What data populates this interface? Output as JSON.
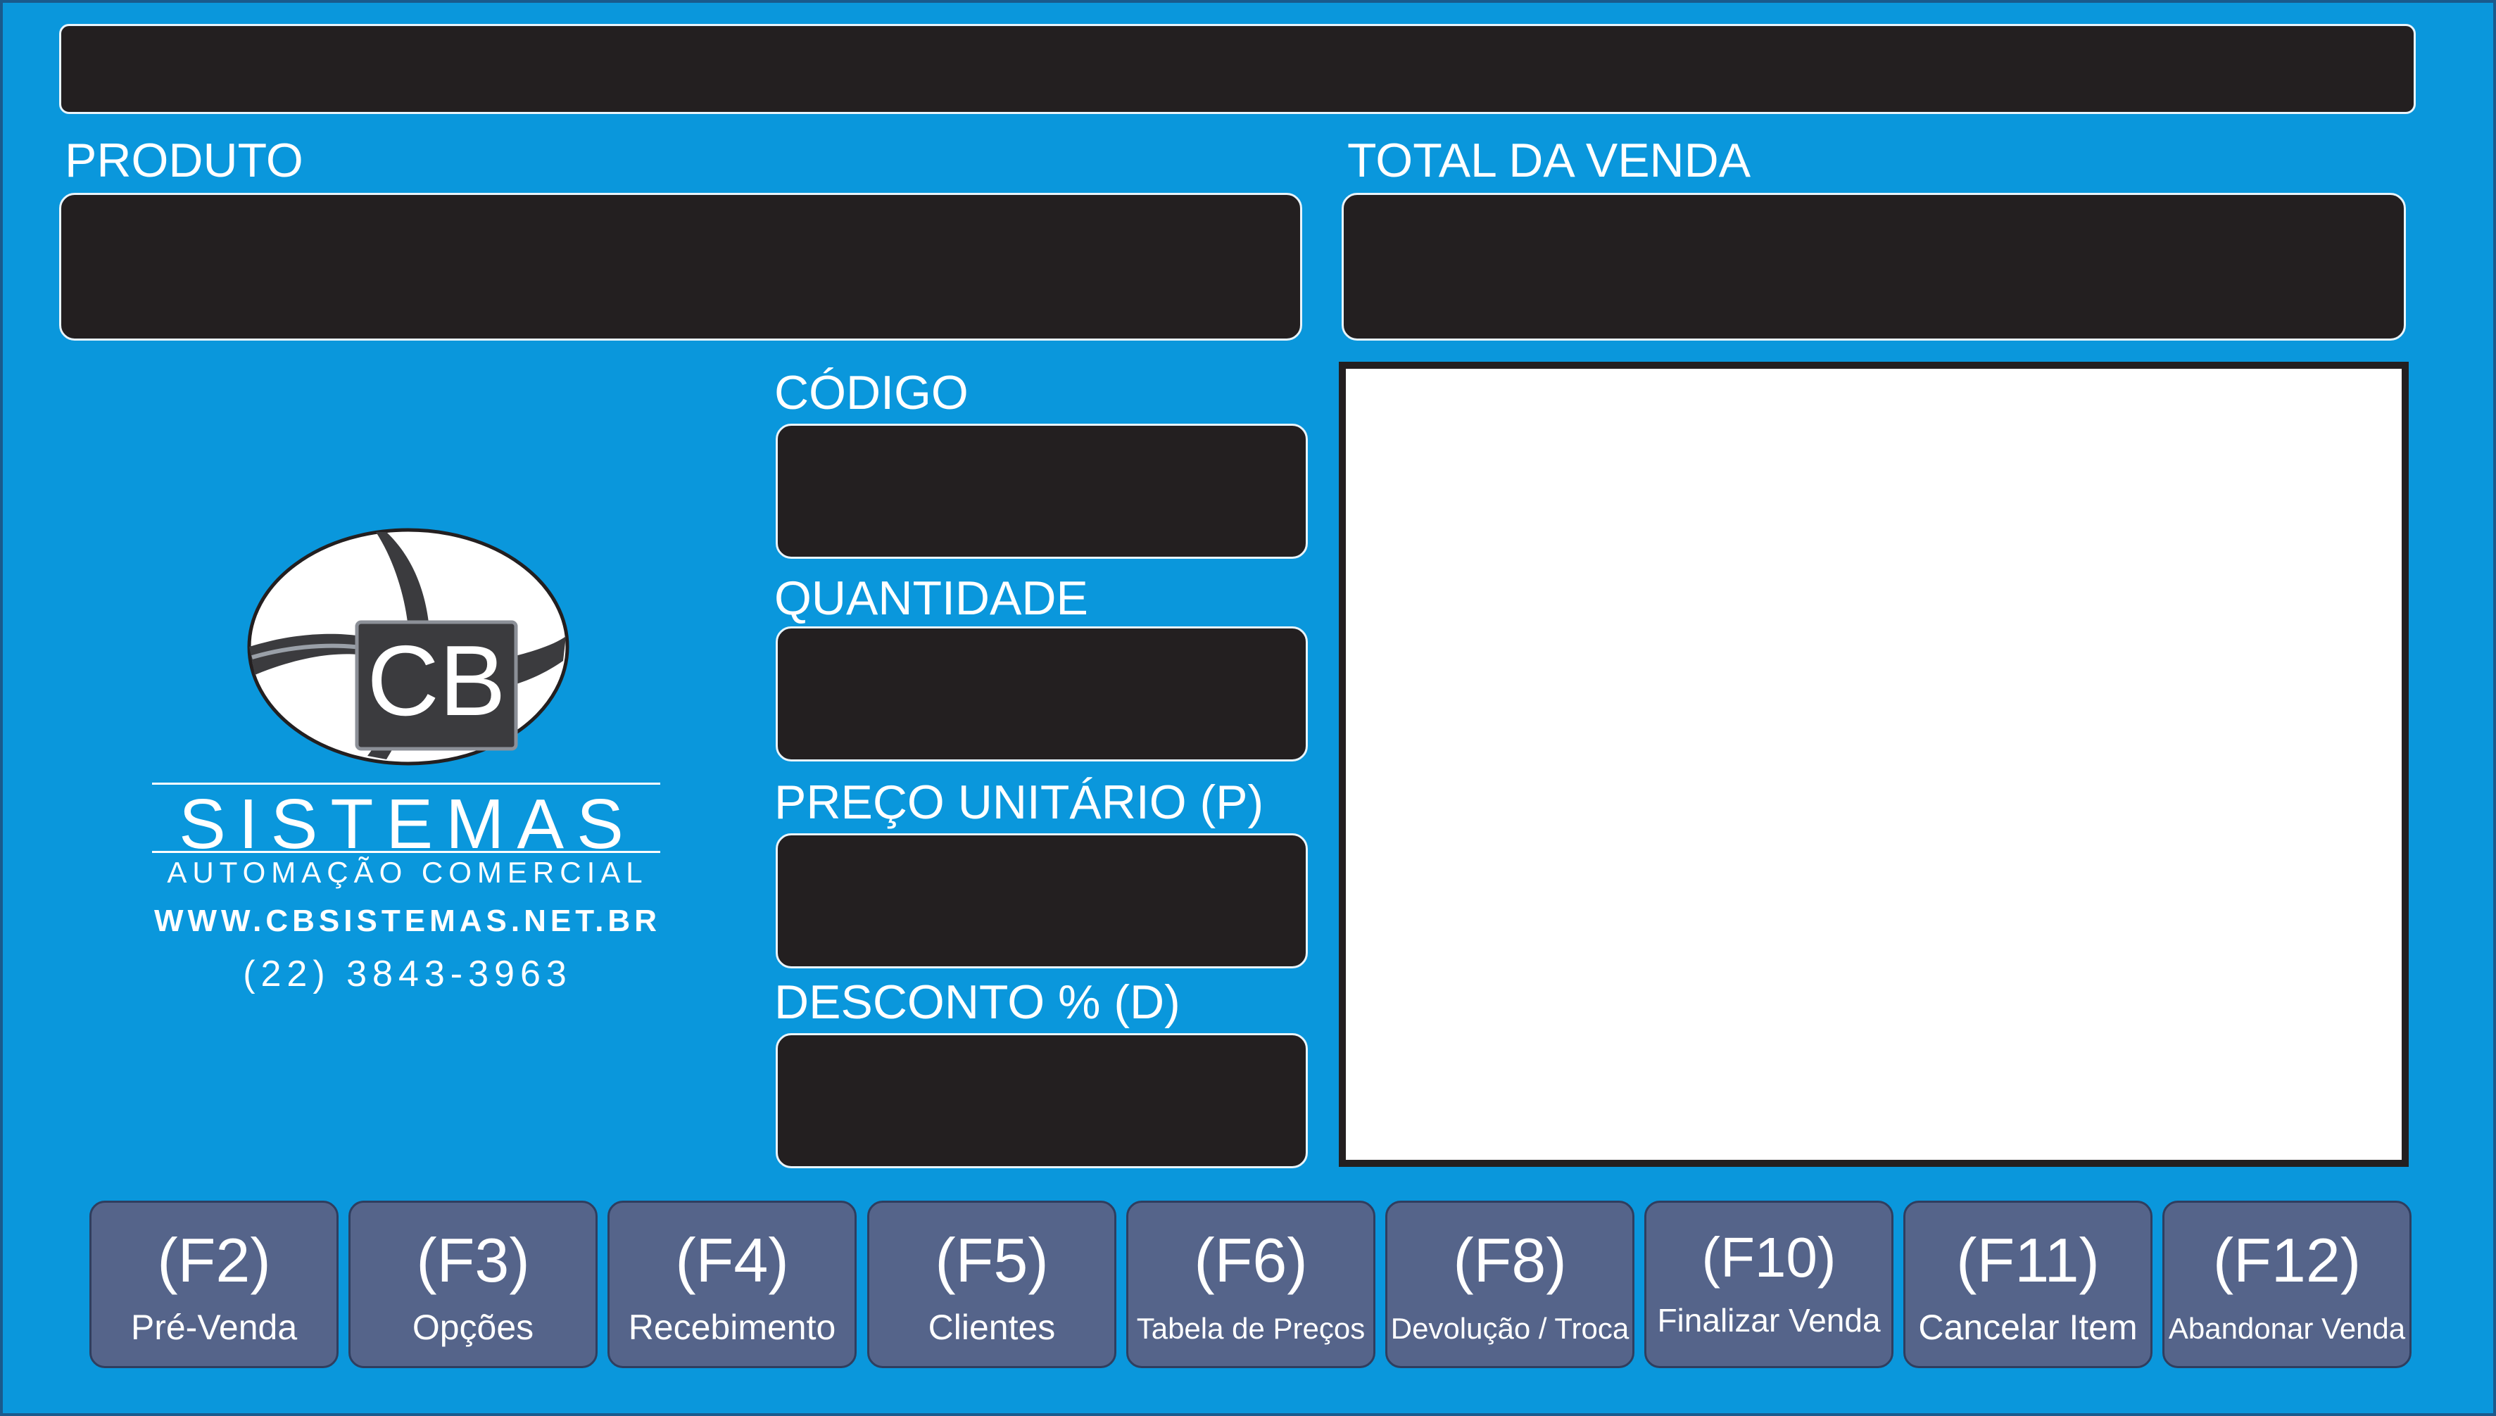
{
  "labels": {
    "produto": "PRODUTO",
    "total_da_venda": "TOTAL DA VENDA",
    "codigo": "CÓDIGO",
    "quantidade": "QUANTIDADE",
    "preco_unitario": "PREÇO UNITÁRIO (P)",
    "desconto": "DESCONTO % (D)"
  },
  "brand": {
    "logo_text": "CB",
    "name": "SISTEMAS",
    "subtitle": "AUTOMAÇÃO COMERCIAL",
    "website": "WWW.CBSISTEMAS.NET.BR",
    "phone": "(22) 3843-3963"
  },
  "function_keys": [
    {
      "key": "(F2)",
      "label": "Pré-Venda"
    },
    {
      "key": "(F3)",
      "label": "Opções"
    },
    {
      "key": "(F4)",
      "label": "Recebimento"
    },
    {
      "key": "(F5)",
      "label": "Clientes"
    },
    {
      "key": "(F6)",
      "label": "Tabela de Preços"
    },
    {
      "key": "(F8)",
      "label": "Devolução / Troca"
    },
    {
      "key": "(F10)",
      "label": "Finalizar Venda"
    },
    {
      "key": "(F11)",
      "label": "Cancelar Item"
    },
    {
      "key": "(F12)",
      "label": "Abandonar Venda"
    }
  ],
  "colors": {
    "background": "#0a97dc",
    "display": "#231f20",
    "button": "#55648a",
    "text": "#ffffff"
  }
}
